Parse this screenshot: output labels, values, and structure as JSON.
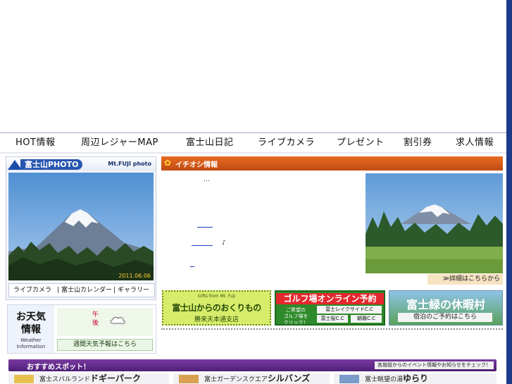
{
  "nav": {
    "items": [
      "HOT情報",
      "周辺レジャーMAP",
      "富士山日記",
      "ライブカメラ",
      "プレゼント",
      "割引券",
      "求人情報"
    ]
  },
  "photo": {
    "title": "富士山PHOTO",
    "subtitle": "Mt.FUJI photo",
    "date": "2011.06.06",
    "links": [
      "ライブカメラ",
      "富士山カレンダー",
      "ギャラリー"
    ]
  },
  "weather": {
    "title_1": "お天気",
    "title_2": "情報",
    "title_en_1": "Weather",
    "title_en_2": "Information",
    "period_1": "午",
    "period_2": "後",
    "weekly_button": "週間天気予報はこちら"
  },
  "pickup": {
    "title": "イチオシ情報",
    "ellipsis": "…",
    "note": "♪",
    "detail_link": "≫詳細はこちらから"
  },
  "banners": {
    "gift_en": "Gifts from Mt. Fuji",
    "gift_title": "富士山からのおくりもの",
    "gift_sub": "勝来天本通支店",
    "golf_title": "ゴルフ場オンライン予約",
    "golf_note_1": "ご希望の",
    "golf_note_2": "ゴルフ場を",
    "golf_note_3": "クリック！",
    "golf_course_1": "富士レイクサイドC.C",
    "golf_course_2": "富士桜C.C",
    "golf_course_3": "朝霧C.C",
    "village_title": "富士緑の休暇村",
    "village_sub": "宿泊のご予約はこちら"
  },
  "osusume": {
    "title": "おすすめスポット！",
    "note": "各施設からのイベント情報やお知らせをチェック！",
    "spots": [
      {
        "prefix": "富士スバルランド",
        "name": "ドギーパーク"
      },
      {
        "prefix": "富士ガーデンスクエア",
        "name": "シルバンズ"
      },
      {
        "prefix": "富士眺望の湯",
        "name": "ゆらり"
      }
    ]
  },
  "colors": {
    "nav_border": "#9aa7c8",
    "right_bar": "#1d3a8a",
    "pickup_header": "#d35a18",
    "osusume_header": "#5f2a8a"
  }
}
